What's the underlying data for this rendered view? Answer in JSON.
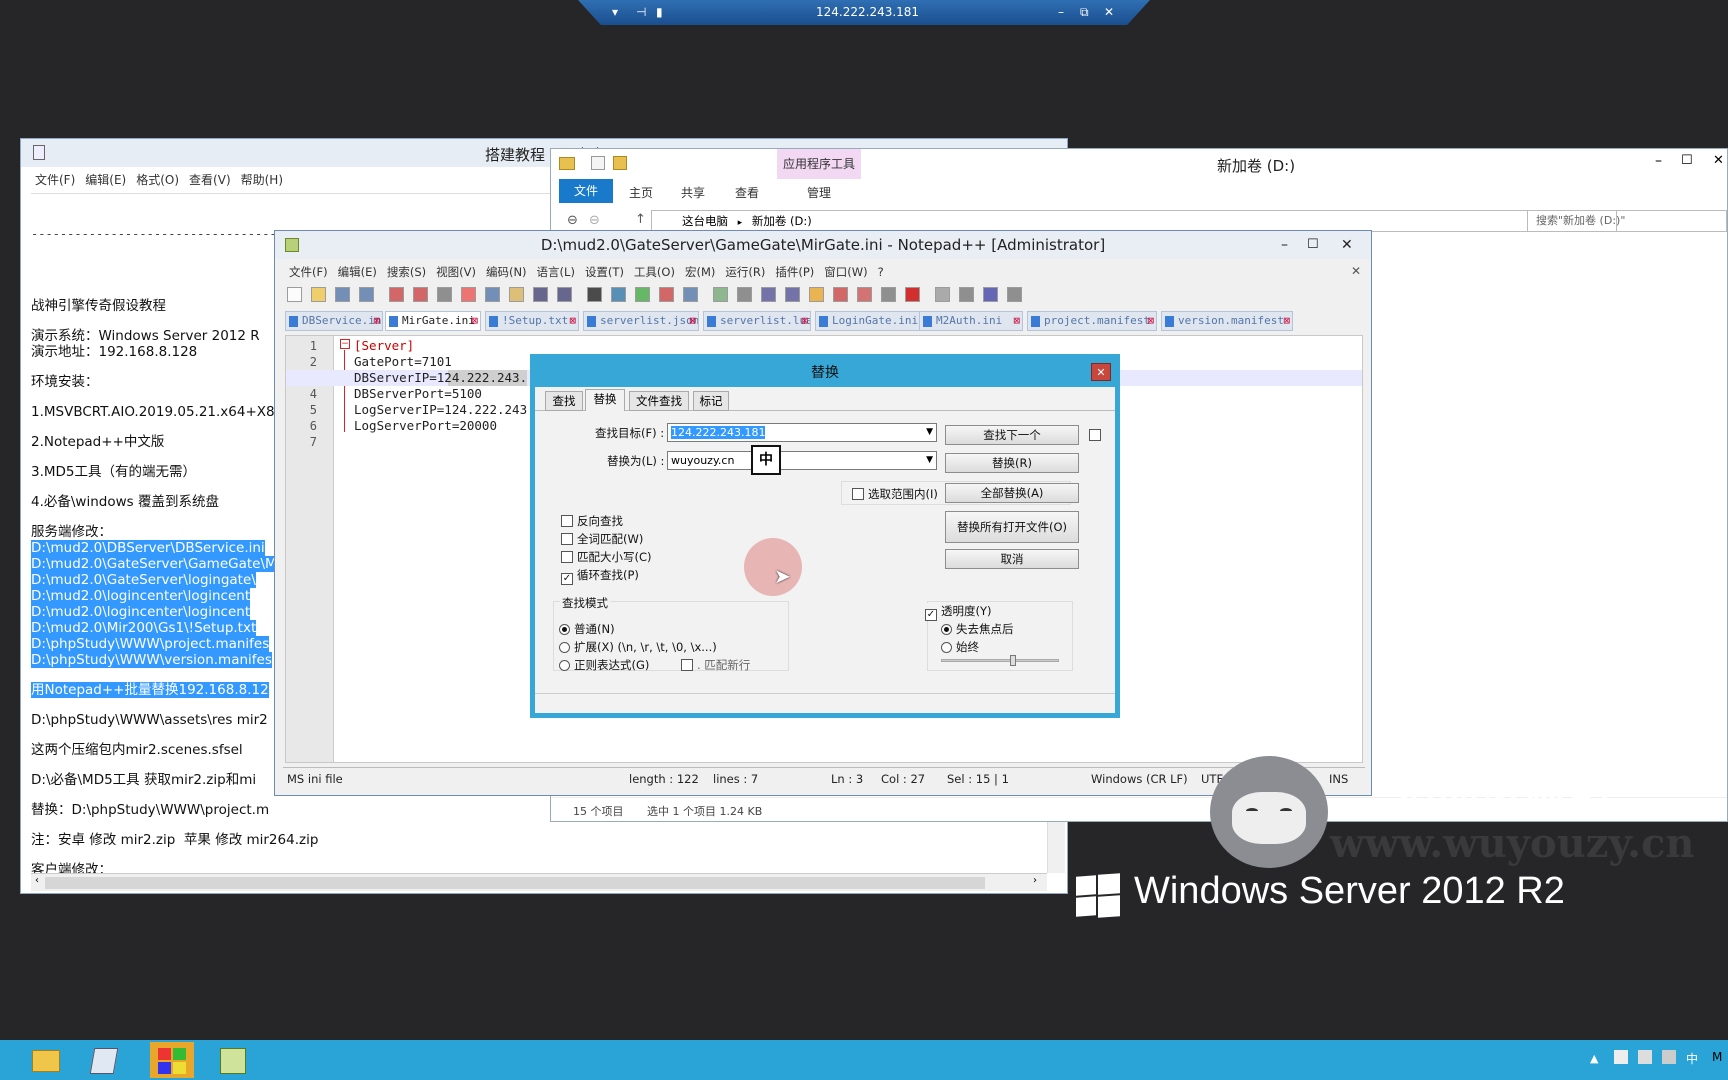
{
  "rdp_bar": {
    "host": "124.222.243.181"
  },
  "notepad": {
    "title": "搭建教程 - 记事本",
    "menu": [
      "文件(F)",
      "编辑(E)",
      "格式(O)",
      "查看(V)",
      "帮助(H)"
    ],
    "lines": [
      {
        "t": "战神引擎传奇假设教程",
        "hl": false
      },
      {
        "t": "演示系统：Windows Server 2012 R",
        "hl": false
      },
      {
        "t": "演示地址：192.168.8.128",
        "hl": false
      },
      {
        "t": "环境安装：",
        "hl": false
      },
      {
        "t": "1.MSVBCRT.AIO.2019.05.21.x64+X8",
        "hl": false
      },
      {
        "t": "2.Notepad++中文版",
        "hl": false
      },
      {
        "t": "3.MD5工具（有的端无需）",
        "hl": false
      },
      {
        "t": "4.必备\\windows 覆盖到系统盘",
        "hl": false
      },
      {
        "t": "服务端修改：",
        "hl": false
      },
      {
        "t": "D:\\mud2.0\\DBServer\\DBService.ini",
        "hl": true
      },
      {
        "t": "D:\\mud2.0\\GateServer\\GameGate\\M",
        "hl": true
      },
      {
        "t": "D:\\mud2.0\\GateServer\\logingate\\",
        "hl": true
      },
      {
        "t": "D:\\mud2.0\\logincenter\\logincent",
        "hl": true
      },
      {
        "t": "D:\\mud2.0\\logincenter\\logincent",
        "hl": true
      },
      {
        "t": "D:\\mud2.0\\Mir200\\Gs1\\!Setup.txt",
        "hl": true
      },
      {
        "t": "D:\\phpStudy\\WWW\\project.manifes",
        "hl": true
      },
      {
        "t": "D:\\phpStudy\\WWW\\version.manifes",
        "hl": true
      },
      {
        "t": "用Notepad++批量替换192.168.8.12",
        "hl": true
      },
      {
        "t": "D:\\phpStudy\\WWW\\assets\\res mir2",
        "hl": false
      },
      {
        "t": "这两个压缩包内mir2.scenes.sfsel",
        "hl": false
      },
      {
        "t": "D:\\必备\\MD5工具 获取mir2.zip和mi",
        "hl": false
      },
      {
        "t": "替换：D:\\phpStudy\\WWW\\project.m",
        "hl": false
      },
      {
        "t": "注：安卓 修改 mir2.zip  苹果 修改 mir264.zip",
        "hl": false
      },
      {
        "t": "客户端修改：",
        "hl": false
      }
    ]
  },
  "explorer": {
    "title": "新加卷 (D:)",
    "ribbon_context": "应用程序工具",
    "tabs": [
      "文件",
      "主页",
      "共享",
      "查看",
      "管理"
    ],
    "breadcrumb": [
      "这台电脑",
      "新加卷 (D:)"
    ],
    "search_placeholder": "搜索\"新加卷 (D:)\"",
    "status_items": "15 个项目",
    "status_selected": "选中 1 个项目  1.24 KB"
  },
  "npp": {
    "title": "D:\\mud2.0\\GateServer\\GameGate\\MirGate.ini - Notepad++ [Administrator]",
    "menu": [
      "文件(F)",
      "编辑(E)",
      "搜索(S)",
      "视图(V)",
      "编码(N)",
      "语言(L)",
      "设置(T)",
      "工具(O)",
      "宏(M)",
      "运行(R)",
      "插件(P)",
      "窗口(W)",
      "?"
    ],
    "tabs": [
      "DBService.ini",
      "MirGate.ini",
      "!Setup.txt",
      "serverlist.json",
      "serverlist.lua",
      "LoginGate.ini",
      "M2Auth.ini",
      "project.manifest",
      "version.manifest"
    ],
    "line_numbers": [
      "1",
      "2",
      "3",
      "4",
      "5",
      "6",
      "7"
    ],
    "code": [
      "[Server]",
      "GatePort=7101",
      "DBServerIP=124.222.243.",
      "DBServerPort=5100",
      "LogServerIP=124.222.243",
      "LogServerPort=20000",
      ""
    ],
    "status": {
      "type": "MS ini file",
      "length": "length : 122",
      "lines": "lines : 7",
      "ln": "Ln : 3",
      "col": "Col : 27",
      "sel": "Sel : 15 | 1",
      "eol": "Windows (CR LF)",
      "enc": "UTF",
      "ins": "INS"
    }
  },
  "dialog": {
    "title": "替换",
    "tabs": [
      "查找",
      "替换",
      "文件查找",
      "标记"
    ],
    "find_label": "查找目标(F) :",
    "find_value": "124.222.243.181",
    "replace_label": "替换为(L) :",
    "replace_value": "wuyouzy.cn",
    "ime": "中",
    "in_selection": "选取范围内(I)",
    "buttons": {
      "find_next": "查找下一个",
      "replace": "替换(R)",
      "replace_all": "全部替换(A)",
      "replace_all_open": "替换所有打开文件(O)",
      "cancel": "取消"
    },
    "options": [
      {
        "label": "反向查找",
        "checked": false
      },
      {
        "label": "全词匹配(W)",
        "checked": false
      },
      {
        "label": "匹配大小写(C)",
        "checked": false
      },
      {
        "label": "循环查找(P)",
        "checked": true
      }
    ],
    "mode_title": "查找模式",
    "modes": [
      {
        "label": "普通(N)",
        "checked": true
      },
      {
        "label": "扩展(X) (\\n, \\r, \\t, \\0, \\x...)",
        "checked": false
      },
      {
        "label": "正则表达式(G)",
        "checked": false
      }
    ],
    "match_newline": ". 匹配新行",
    "transparency": "透明度(Y)",
    "trans_modes": [
      {
        "label": "失去焦点后",
        "checked": true
      },
      {
        "label": "始终",
        "checked": false
      }
    ],
    "transparency_level": 0.6
  },
  "watermark": {
    "site_name": "无忧资源站",
    "site_url": "www.wuyouzy.cn",
    "os": "Windows Server 2012 R2"
  }
}
